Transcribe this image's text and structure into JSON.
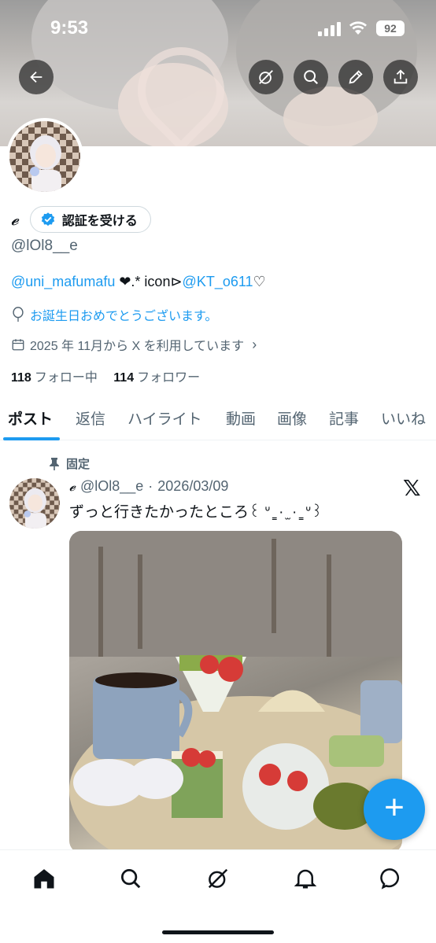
{
  "status_bar": {
    "time": "9:53",
    "battery": "92"
  },
  "profile": {
    "name": "𝓮",
    "verify_label": "認証を受ける",
    "handle": "@lOl8__e",
    "bio_link1": "@uni_mafumafu",
    "bio_mid": " ❤︎.* icon⊳",
    "bio_link2": "@KT_o611",
    "bio_end": "♡",
    "birthday": "お誕生日おめでとうございます。",
    "joined": "2025 年 11月から X を利用しています",
    "following_count": "118",
    "following_label": "フォロー中",
    "followers_count": "114",
    "followers_label": "フォロワー"
  },
  "tabs": [
    "ポスト",
    "返信",
    "ハイライト",
    "動画",
    "画像",
    "記事",
    "いいね"
  ],
  "post": {
    "pinned_label": "固定",
    "name": "𝓮",
    "handle": "@lOl8__e",
    "date": "2026/03/09",
    "text": "ずっと行きたかったところ꒰ ᐡ ̳ · ̫ · ̳ ᐡ꒱"
  },
  "colors": {
    "accent": "#1d9bf0",
    "text": "#0f1419",
    "secondary": "#536471"
  },
  "icons": [
    "back-icon",
    "grok-icon",
    "search-icon",
    "edit-icon",
    "share-icon",
    "verified-icon",
    "balloon-icon",
    "calendar-icon",
    "pin-icon",
    "x-logo-icon",
    "plus-icon",
    "home-icon",
    "bell-icon",
    "chat-icon"
  ]
}
